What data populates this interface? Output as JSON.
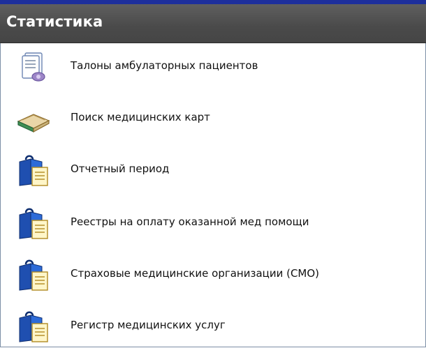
{
  "panel": {
    "title": "Статистика"
  },
  "menu": {
    "items": [
      {
        "label": "Талоны амбулаторных пациентов",
        "icon": "document-certificate-icon"
      },
      {
        "label": "Поиск медицинских карт",
        "icon": "book-icon"
      },
      {
        "label": "Отчетный период",
        "icon": "document-folder-icon"
      },
      {
        "label": "Реестры на оплату оказанной мед помощи",
        "icon": "document-folder-icon"
      },
      {
        "label": "Страховые медицинские организации (СМО)",
        "icon": "document-folder-icon"
      },
      {
        "label": "Регистр медицинских услуг",
        "icon": "document-folder-icon"
      }
    ]
  },
  "colors": {
    "header_bg": "#4a4a4a",
    "top_accent": "#1d2f9c",
    "text": "#111111"
  }
}
